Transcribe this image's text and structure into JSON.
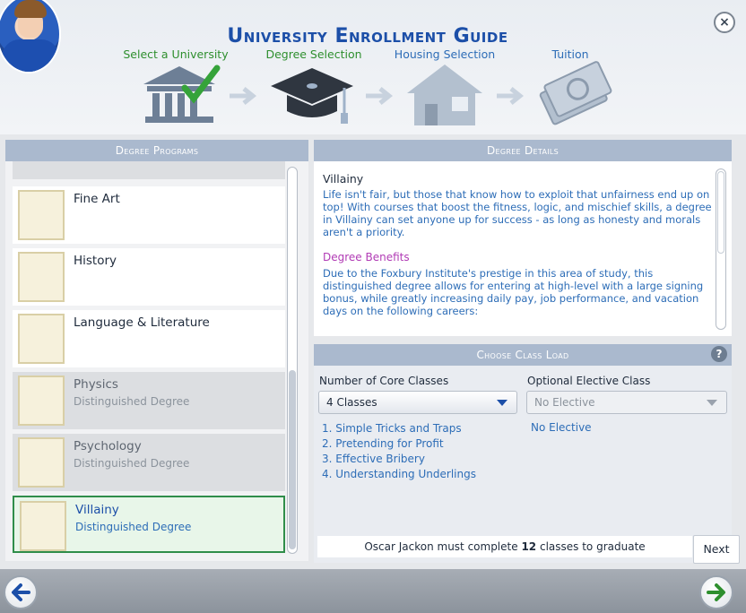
{
  "header": {
    "title": "University Enrollment Guide",
    "steps": [
      {
        "label": "Select a University",
        "state": "done",
        "icon": "university-building-icon"
      },
      {
        "label": "Degree Selection",
        "state": "current",
        "icon": "graduation-cap-icon"
      },
      {
        "label": "Housing Selection",
        "state": "pending",
        "icon": "house-icon"
      },
      {
        "label": "Tuition",
        "state": "pending",
        "icon": "money-icon"
      }
    ]
  },
  "degree_programs": {
    "header": "Degree Programs",
    "items": [
      {
        "name": "Fine Art",
        "sub": "",
        "state": "normal",
        "icon": "fine-art-diploma-icon"
      },
      {
        "name": "History",
        "sub": "",
        "state": "normal",
        "icon": "history-diploma-icon"
      },
      {
        "name": "Language & Literature",
        "sub": "",
        "state": "normal",
        "icon": "literature-diploma-icon"
      },
      {
        "name": "Physics",
        "sub": "Distinguished Degree",
        "state": "dim",
        "icon": "physics-diploma-icon"
      },
      {
        "name": "Psychology",
        "sub": "Distinguished Degree",
        "state": "dim",
        "icon": "psychology-diploma-icon"
      },
      {
        "name": "Villainy",
        "sub": "Distinguished Degree",
        "state": "selected",
        "icon": "villainy-diploma-icon"
      }
    ]
  },
  "degree_details": {
    "header": "Degree Details",
    "title": "Villainy",
    "description": "Life isn't fair, but those that know how to exploit that unfairness end up on top! With courses that boost the fitness, logic, and mischief skills, a degree in Villainy can set anyone up for success - as long as honesty and morals aren't a priority.",
    "benefits_title": "Degree Benefits",
    "benefits_text": "Due to the Foxbury Institute's prestige in this area of study, this distinguished degree allows for entering at high-level with a large signing bonus, while greatly increasing daily pay, job performance, and vacation days on the following careers:"
  },
  "class_load": {
    "header": "Choose Class Load",
    "core_label": "Number of Core Classes",
    "core_value": "4 Classes",
    "elective_label": "Optional Elective Class",
    "elective_value": "No Elective",
    "elective_selected": "No Elective",
    "classes": [
      "1. Simple Tricks and Traps",
      "2. Pretending for Profit",
      "3. Effective Bribery",
      "4. Understanding Underlings"
    ],
    "footer_prefix": "Oscar Jackon must complete",
    "footer_count": "12",
    "footer_suffix": "classes to graduate"
  },
  "nav": {
    "next_label": "Next",
    "help_symbol": "?",
    "close_symbol": "×"
  },
  "colors": {
    "accent_blue": "#1c4fa8",
    "link_blue": "#2d6db7",
    "done_green": "#2e8f2e",
    "benefit_purple": "#b13bb5",
    "selected_border": "#2f8d4a"
  }
}
